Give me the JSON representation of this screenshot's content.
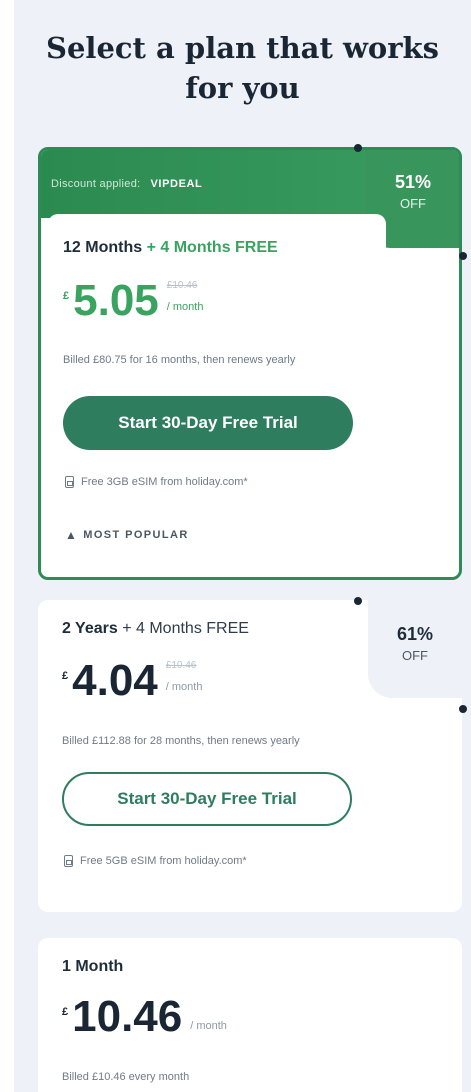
{
  "page": {
    "heading": "Select a plan that works for you"
  },
  "plans": [
    {
      "discount_label": "Discount applied:",
      "discount_code": "VIPDEAL",
      "badge_percent": "51%",
      "badge_off": "OFF",
      "title": "12 Months",
      "free_text": "+ 4 Months FREE",
      "currency": "£",
      "price": "5.05",
      "old_price": "£10.46",
      "per": "/ month",
      "billed": "Billed £80.75 for 16 months, then renews yearly",
      "cta": "Start 30-Day Free Trial",
      "esim": "Free 3GB eSIM from holiday.com*",
      "popular": "MOST POPULAR"
    },
    {
      "badge_percent": "61%",
      "badge_off": "OFF",
      "title": "2 Years",
      "free_text": "+ 4 Months FREE",
      "currency": "£",
      "price": "4.04",
      "old_price": "£10.46",
      "per": "/ month",
      "billed": "Billed £112.88 for 28 months, then renews yearly",
      "cta": "Start 30-Day Free Trial",
      "esim": "Free 5GB eSIM from holiday.com*"
    },
    {
      "title": "1 Month",
      "currency": "£",
      "price": "10.46",
      "per": "/ month",
      "billed": "Billed £10.46 every month"
    }
  ],
  "icons": {
    "esim": "sim-card-icon",
    "popular": "flame-icon"
  },
  "colors": {
    "accent_green": "#3aa35f",
    "button_green": "#2e7d5f",
    "card_border": "#2e8b57",
    "panel_bg": "#eef2f8"
  }
}
